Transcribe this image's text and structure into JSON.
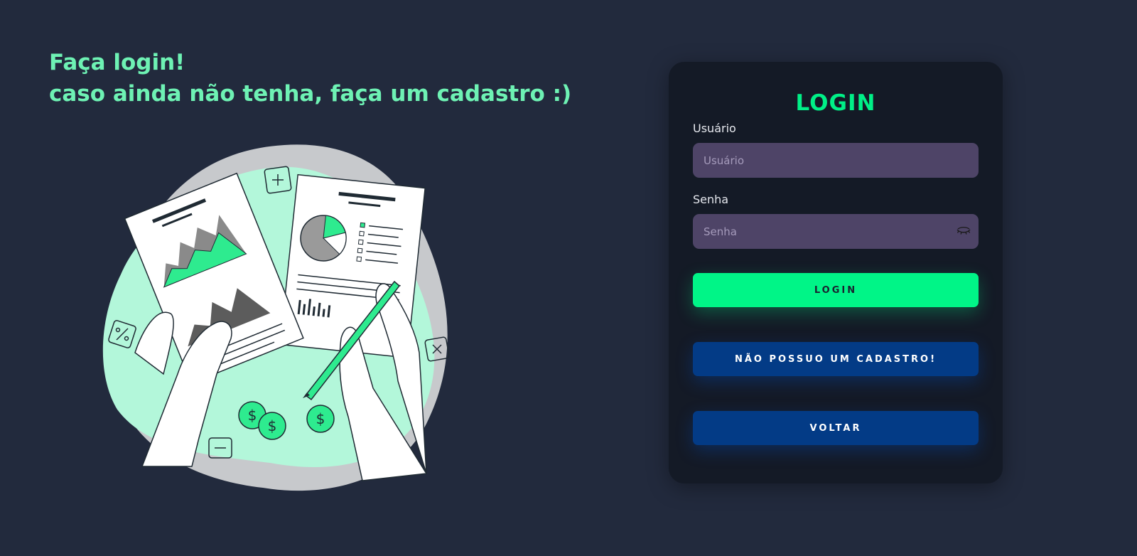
{
  "hero": {
    "line1": "Faça login!",
    "line2": "caso ainda não tenha, faça um cadastro :)"
  },
  "login_form": {
    "title": "LOGIN",
    "username_label": "Usuário",
    "username_placeholder": "Usuário",
    "password_label": "Senha",
    "password_placeholder": "Senha",
    "password_toggle_icon": "eye-closed-icon",
    "login_button": "LOGIN",
    "register_button": "NÃO POSSUO UM CADASTRO!",
    "back_button": "VOLTAR"
  },
  "colors": {
    "background": "#222a3d",
    "panel": "#141a26",
    "accent_green": "#00f587",
    "headline_green": "#6ef2b4",
    "input_bg": "#4e4467",
    "button_blue": "#033b86"
  },
  "illustration": {
    "icon": "finance-report-illustration"
  }
}
